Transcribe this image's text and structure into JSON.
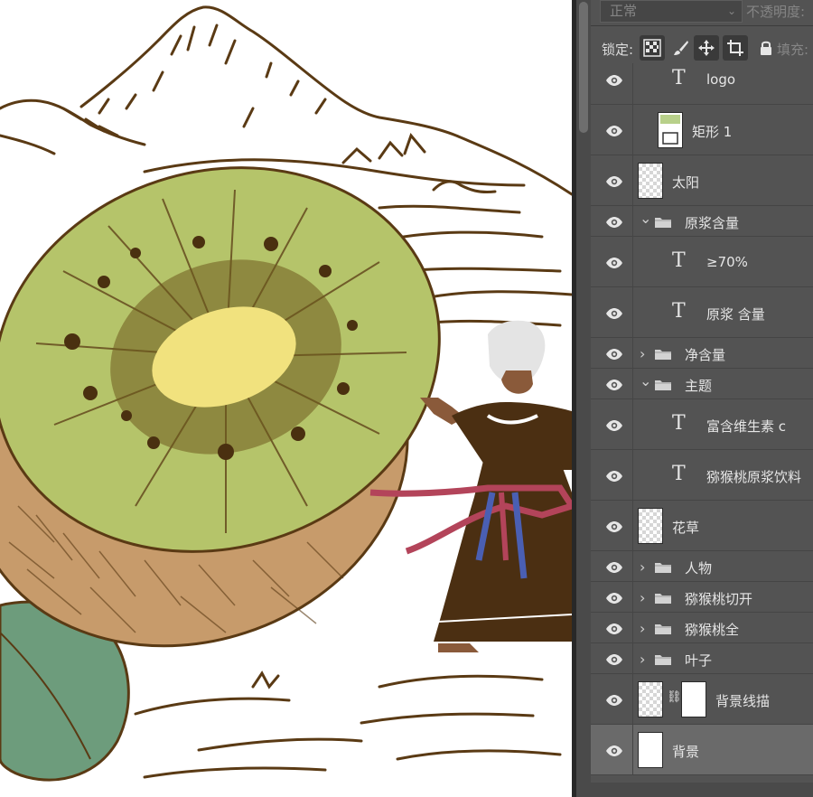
{
  "panel": {
    "blend_mode": "正常",
    "opacity_label": "不透明度:",
    "lock_label": "锁定:",
    "fill_label": "填充:"
  },
  "layers": [
    {
      "id": "logo",
      "name": "logo",
      "kind": "text",
      "indent": 1
    },
    {
      "id": "rect1",
      "name": "矩形 1",
      "kind": "shape",
      "indent": 1
    },
    {
      "id": "sun",
      "name": "太阳",
      "kind": "raster",
      "indent": 0
    },
    {
      "id": "juice-group",
      "name": "原浆含量",
      "kind": "group-open",
      "indent": 0
    },
    {
      "id": "pct70",
      "name": "≥70%",
      "kind": "text",
      "indent": 1
    },
    {
      "id": "juice-text",
      "name": "原浆 含量",
      "kind": "text",
      "indent": 1
    },
    {
      "id": "net-group",
      "name": "净含量",
      "kind": "group-closed",
      "indent": 0
    },
    {
      "id": "theme-group",
      "name": "主题",
      "kind": "group-open",
      "indent": 0
    },
    {
      "id": "vitc",
      "name": "富含维生素 c",
      "kind": "text",
      "indent": 1
    },
    {
      "id": "drink",
      "name": "猕猴桃原浆饮料",
      "kind": "text",
      "indent": 1
    },
    {
      "id": "flowers",
      "name": "花草",
      "kind": "raster",
      "indent": 0
    },
    {
      "id": "person-group",
      "name": "人物",
      "kind": "group-closed",
      "indent": 0
    },
    {
      "id": "kiwi-cut-group",
      "name": "猕猴桃切开",
      "kind": "group-closed",
      "indent": 0
    },
    {
      "id": "kiwi-whole-group",
      "name": "猕猴桃全",
      "kind": "group-closed",
      "indent": 0
    },
    {
      "id": "leaf-group",
      "name": "叶子",
      "kind": "group-closed",
      "indent": 0
    },
    {
      "id": "bg-lines",
      "name": "背景线描",
      "kind": "masked",
      "indent": 0
    },
    {
      "id": "bg",
      "name": "背景",
      "kind": "white",
      "indent": 0,
      "selected": true
    }
  ],
  "icons": {
    "eye": "eye-icon",
    "text_layer": "T",
    "folder": "folder-icon",
    "chain": "link-icon"
  },
  "colors": {
    "panel_bg": "#535353",
    "selected_row": "#6a6a6a",
    "kiwi_flesh": "#b5c46a",
    "kiwi_center": "#f1e27e",
    "kiwi_skin": "#c79b6b",
    "ink": "#5a3a14",
    "leaf": "#6d9c7c",
    "dress": "#4b2f12",
    "sash_red": "#b3445a",
    "sash_blue": "#4a5fb3"
  }
}
